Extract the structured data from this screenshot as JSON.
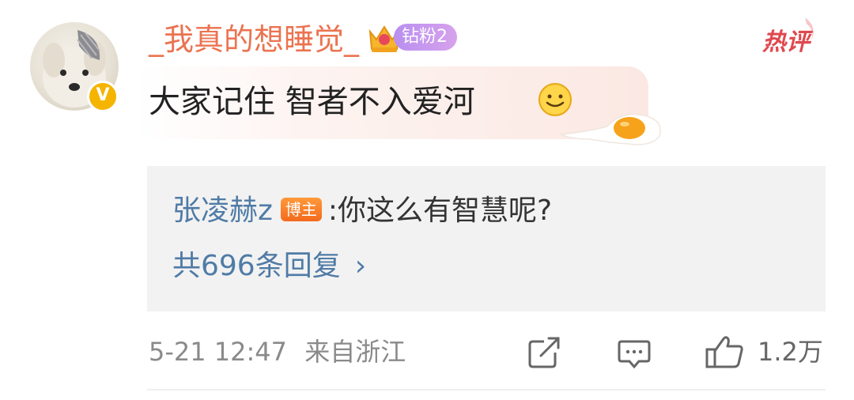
{
  "comment": {
    "username": "_我真的想睡觉_",
    "fan_badge": "钻粉2",
    "hot_tag": "热评",
    "text": "大家记住 智者不入爱河",
    "verified_mark": "V"
  },
  "reply": {
    "author": "张凌赫z",
    "author_badge": "博主",
    "separator": ":",
    "text": "你这么有智慧呢?",
    "count_label": "共696条回复",
    "chevron": "›"
  },
  "footer": {
    "timestamp": "5-21 12:47",
    "location": "来自浙江",
    "like_count": "1.2万"
  },
  "icons": {
    "share": "share-icon",
    "comment": "comment-icon",
    "like": "thumbs-up-icon",
    "crown": "crown-icon",
    "smiley": "smiley-emoji-icon",
    "egg": "fried-egg-sticker"
  },
  "colors": {
    "username": "#eb7350",
    "link_blue": "#4f7ba6",
    "hot_red": "#e0484f",
    "meta_gray": "#8a8a8a",
    "reply_bg": "#f2f2f2",
    "verified_gold": "#f5b400"
  }
}
